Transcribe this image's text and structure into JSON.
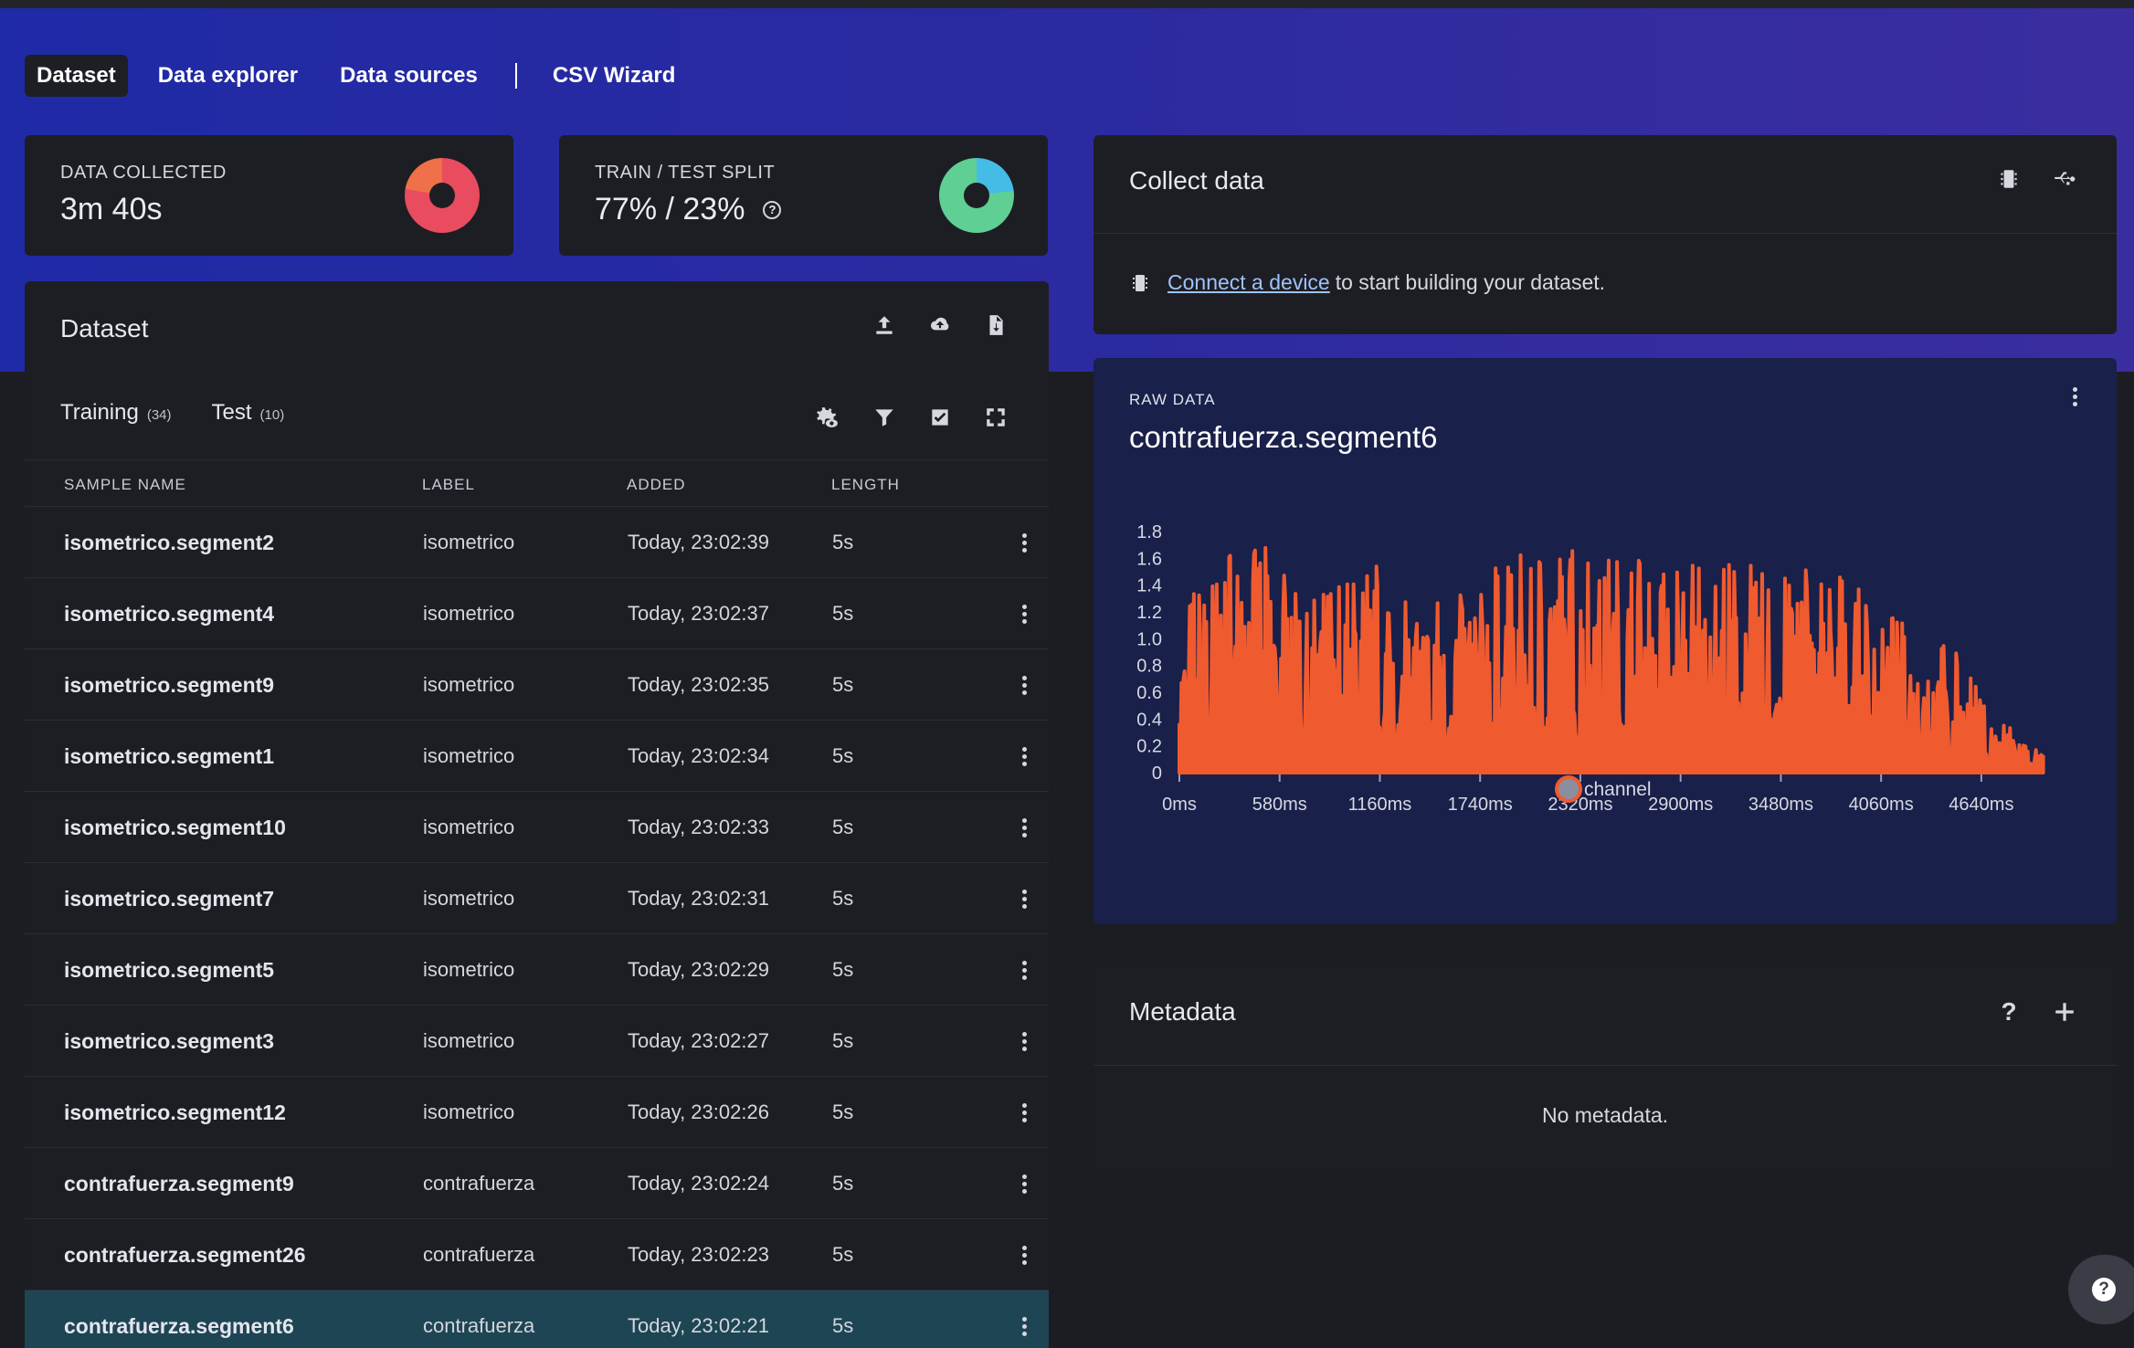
{
  "nav": {
    "items": [
      {
        "label": "Dataset",
        "active": true
      },
      {
        "label": "Data explorer",
        "active": false
      },
      {
        "label": "Data sources",
        "active": false
      },
      {
        "label": "CSV Wizard",
        "active": false
      }
    ]
  },
  "stats": {
    "collected": {
      "label": "DATA COLLECTED",
      "value": "3m 40s"
    },
    "split": {
      "label": "TRAIN / TEST SPLIT",
      "value": "77% / 23%",
      "train_fraction": 0.77
    }
  },
  "dataset": {
    "title": "Dataset",
    "tabs": [
      {
        "label": "Training",
        "count": "(34)"
      },
      {
        "label": "Test",
        "count": "(10)"
      }
    ],
    "columns": {
      "name": "SAMPLE NAME",
      "label": "LABEL",
      "added": "ADDED",
      "length": "LENGTH"
    },
    "rows": [
      {
        "name": "isometrico.segment2",
        "label": "isometrico",
        "added": "Today, 23:02:39",
        "length": "5s"
      },
      {
        "name": "isometrico.segment4",
        "label": "isometrico",
        "added": "Today, 23:02:37",
        "length": "5s"
      },
      {
        "name": "isometrico.segment9",
        "label": "isometrico",
        "added": "Today, 23:02:35",
        "length": "5s"
      },
      {
        "name": "isometrico.segment1",
        "label": "isometrico",
        "added": "Today, 23:02:34",
        "length": "5s"
      },
      {
        "name": "isometrico.segment10",
        "label": "isometrico",
        "added": "Today, 23:02:33",
        "length": "5s"
      },
      {
        "name": "isometrico.segment7",
        "label": "isometrico",
        "added": "Today, 23:02:31",
        "length": "5s"
      },
      {
        "name": "isometrico.segment5",
        "label": "isometrico",
        "added": "Today, 23:02:29",
        "length": "5s"
      },
      {
        "name": "isometrico.segment3",
        "label": "isometrico",
        "added": "Today, 23:02:27",
        "length": "5s"
      },
      {
        "name": "isometrico.segment12",
        "label": "isometrico",
        "added": "Today, 23:02:26",
        "length": "5s"
      },
      {
        "name": "contrafuerza.segment9",
        "label": "contrafuerza",
        "added": "Today, 23:02:24",
        "length": "5s"
      },
      {
        "name": "contrafuerza.segment26",
        "label": "contrafuerza",
        "added": "Today, 23:02:23",
        "length": "5s"
      },
      {
        "name": "contrafuerza.segment6",
        "label": "contrafuerza",
        "added": "Today, 23:02:21",
        "length": "5s",
        "selected": true
      }
    ]
  },
  "collect": {
    "title": "Collect data",
    "link": "Connect a device",
    "message": "to start building your dataset."
  },
  "raw": {
    "label": "RAW DATA",
    "title": "contrafuerza.segment6"
  },
  "chart_data": {
    "type": "area",
    "series": [
      {
        "name": "channel",
        "color": "#f05a2f"
      }
    ],
    "x_tick_labels": [
      "0ms",
      "580ms",
      "1160ms",
      "1740ms",
      "2320ms",
      "2900ms",
      "3480ms",
      "4060ms",
      "4640ms"
    ],
    "y_tick_labels": [
      "0",
      "0.2",
      "0.4",
      "0.6",
      "0.8",
      "1.0",
      "1.2",
      "1.4",
      "1.6",
      "1.8"
    ],
    "ylim": [
      0,
      1.8
    ],
    "xlim": [
      0,
      5000
    ],
    "legend": "bottom",
    "envelope": [
      {
        "x": 0,
        "y": 1.1
      },
      {
        "x": 100,
        "y": 1.4
      },
      {
        "x": 300,
        "y": 1.65
      },
      {
        "x": 500,
        "y": 1.68
      },
      {
        "x": 800,
        "y": 1.3
      },
      {
        "x": 1100,
        "y": 1.6
      },
      {
        "x": 1300,
        "y": 1.45
      },
      {
        "x": 1500,
        "y": 1.35
      },
      {
        "x": 1700,
        "y": 1.45
      },
      {
        "x": 1950,
        "y": 1.62
      },
      {
        "x": 2300,
        "y": 1.68
      },
      {
        "x": 2600,
        "y": 1.65
      },
      {
        "x": 2850,
        "y": 1.55
      },
      {
        "x": 3050,
        "y": 1.6
      },
      {
        "x": 3300,
        "y": 1.55
      },
      {
        "x": 3600,
        "y": 1.6
      },
      {
        "x": 3850,
        "y": 1.45
      },
      {
        "x": 4200,
        "y": 1.1
      },
      {
        "x": 4500,
        "y": 0.9
      },
      {
        "x": 4700,
        "y": 0.45
      },
      {
        "x": 4900,
        "y": 0.25
      },
      {
        "x": 5000,
        "y": 0.12
      }
    ]
  },
  "metadata": {
    "title": "Metadata",
    "empty": "No metadata."
  },
  "colors": {
    "accent": "#f05a2f",
    "donut_collected_a": "#e84c5e",
    "donut_collected_b": "#f0704a",
    "donut_split_train": "#5fcf93",
    "donut_split_test": "#45bce6"
  }
}
